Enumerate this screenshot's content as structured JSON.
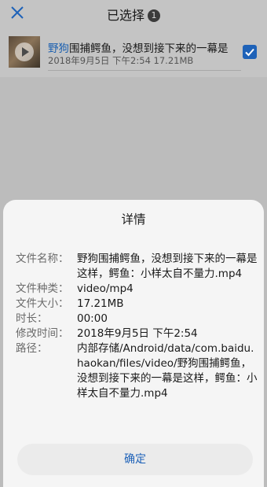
{
  "header": {
    "title": "已选择",
    "count": "1"
  },
  "file": {
    "name_highlight": "野狗",
    "name_rest": "围捕鳄鱼，没想到接下来的一幕是",
    "meta": "2018年9月5日 下午2:54 17.21MB"
  },
  "dialog": {
    "title": "详情",
    "rows": [
      {
        "label": "文件名称：",
        "value": "野狗围捕鳄鱼，没想到接下来的一幕是这样，鳄鱼：小样太自不量力.mp4"
      },
      {
        "label": "文件种类：",
        "value": "video/mp4"
      },
      {
        "label": "文件大小：",
        "value": "17.21MB"
      },
      {
        "label": "时长：",
        "value": "00:00"
      },
      {
        "label": "修改时间：",
        "value": "2018年9月5日 下午2:54"
      },
      {
        "label": "路径：",
        "value": "内部存储/Android/data/com.baidu.haokan/files/video/野狗围捕鳄鱼，没想到接下来的一幕是这样，鳄鱼：小样太自不量力.mp4"
      }
    ],
    "confirm_label": "确定"
  },
  "colors": {
    "accent": "#1e62b8",
    "highlight_text": "#1a5fb0"
  }
}
